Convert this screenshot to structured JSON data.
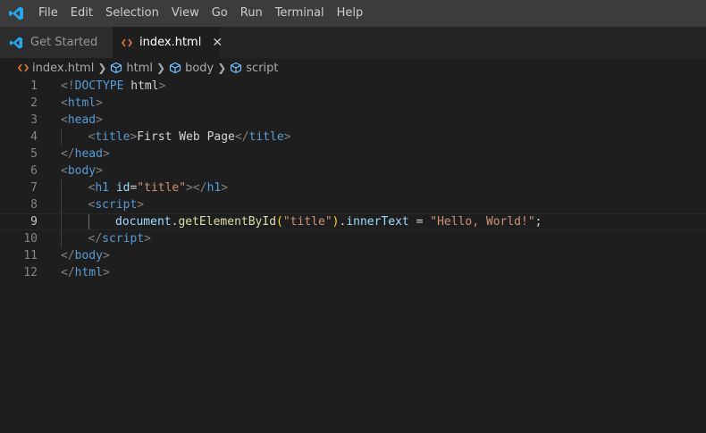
{
  "menu": [
    "File",
    "Edit",
    "Selection",
    "View",
    "Go",
    "Run",
    "Terminal",
    "Help"
  ],
  "tabs": [
    {
      "label": "Get Started",
      "icon": "vscode-logo-icon",
      "active": false
    },
    {
      "label": "index.html",
      "icon": "html-file-icon",
      "active": true,
      "close": "✕"
    }
  ],
  "breadcrumb": [
    {
      "label": "index.html",
      "icon": "html-file-icon"
    },
    {
      "label": "html",
      "icon": "element-cube-icon"
    },
    {
      "label": "body",
      "icon": "element-cube-icon"
    },
    {
      "label": "script",
      "icon": "element-cube-icon"
    }
  ],
  "editor": {
    "current_line": 9,
    "lines": [
      {
        "n": "1",
        "tokens": [
          [
            "p",
            "<!"
          ],
          [
            "kw",
            "DOCTYPE "
          ],
          [
            "txt",
            "html"
          ],
          [
            "p",
            ">"
          ]
        ]
      },
      {
        "n": "2",
        "tokens": [
          [
            "p",
            "<"
          ],
          [
            "t",
            "html"
          ],
          [
            "p",
            ">"
          ]
        ]
      },
      {
        "n": "3",
        "tokens": [
          [
            "p",
            "<"
          ],
          [
            "t",
            "head"
          ],
          [
            "p",
            ">"
          ]
        ]
      },
      {
        "n": "4",
        "indent": 1,
        "tokens": [
          [
            "p",
            "<"
          ],
          [
            "t",
            "title"
          ],
          [
            "p",
            ">"
          ],
          [
            "txt",
            "First Web Page"
          ],
          [
            "p",
            "</"
          ],
          [
            "t",
            "title"
          ],
          [
            "p",
            ">"
          ]
        ]
      },
      {
        "n": "5",
        "tokens": [
          [
            "p",
            "</"
          ],
          [
            "t",
            "head"
          ],
          [
            "p",
            ">"
          ]
        ]
      },
      {
        "n": "6",
        "tokens": [
          [
            "p",
            "<"
          ],
          [
            "t",
            "body"
          ],
          [
            "p",
            ">"
          ]
        ]
      },
      {
        "n": "7",
        "indent": 1,
        "tokens": [
          [
            "p",
            "<"
          ],
          [
            "t",
            "h1 "
          ],
          [
            "a",
            "id"
          ],
          [
            "txt",
            "="
          ],
          [
            "s",
            "\"title\""
          ],
          [
            "p",
            "></"
          ],
          [
            "t",
            "h1"
          ],
          [
            "p",
            ">"
          ]
        ]
      },
      {
        "n": "8",
        "indent": 1,
        "tokens": [
          [
            "p",
            "<"
          ],
          [
            "t",
            "script"
          ],
          [
            "p",
            ">"
          ]
        ]
      },
      {
        "n": "9",
        "indent": 2,
        "tokens": [
          [
            "a",
            "document"
          ],
          [
            "txt",
            "."
          ],
          [
            "f",
            "getElementById"
          ],
          [
            "br",
            "("
          ],
          [
            "s",
            "\"title\""
          ],
          [
            "br",
            ")"
          ],
          [
            "txt",
            "."
          ],
          [
            "a",
            "innerText"
          ],
          [
            "txt",
            " = "
          ],
          [
            "s",
            "\"Hello, World!\""
          ],
          [
            "txt",
            ";"
          ]
        ]
      },
      {
        "n": "10",
        "indent": 1,
        "tokens": [
          [
            "p",
            "</"
          ],
          [
            "t",
            "script"
          ],
          [
            "p",
            ">"
          ]
        ]
      },
      {
        "n": "11",
        "tokens": [
          [
            "p",
            "</"
          ],
          [
            "t",
            "body"
          ],
          [
            "p",
            ">"
          ]
        ]
      },
      {
        "n": "12",
        "tokens": [
          [
            "p",
            "</"
          ],
          [
            "t",
            "html"
          ],
          [
            "p",
            ">"
          ]
        ]
      }
    ]
  },
  "colors": {
    "accent_blue": "#23a9f2",
    "html_icon_orange": "#e37933",
    "cube_icon_blue": "#75beff"
  }
}
